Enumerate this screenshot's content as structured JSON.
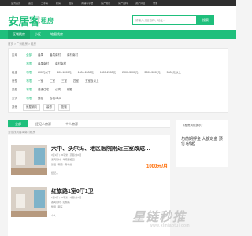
{
  "topbar": [
    "设为首页",
    "首页",
    "二手房",
    "新房",
    "租房",
    "商铺写字楼",
    "房产资讯",
    "房产百科",
    "资产评估",
    "登录"
  ],
  "header": {
    "logo": "安居客",
    "section": "租房",
    "search_placeholder": "请输入小区名称、地址…",
    "search_button": "搜索"
  },
  "nav": {
    "items": [
      "区域找房",
      "小区",
      "地图找房"
    ]
  },
  "breadcrumb": "首页 > 广州租房 > 租房",
  "filters": {
    "rows": [
      {
        "label": "区域",
        "options": [
          "全部",
          "番禺",
          "番禺南村",
          "南村南村"
        ]
      },
      {
        "label": "",
        "options": [
          "不限",
          "番禺南村",
          "南村南村"
        ]
      },
      {
        "label": "租金",
        "options": [
          "不限",
          "600元以下",
          "600-1000元",
          "1000-1500元",
          "1500-2000元",
          "2000-3000元",
          "3000-5000元",
          "5000元以上"
        ]
      },
      {
        "label": "房型",
        "options": [
          "不限",
          "一室",
          "二室",
          "三室",
          "四室",
          "五室及以上"
        ]
      },
      {
        "label": "类型",
        "options": [
          "不限",
          "普通住宅",
          "公寓",
          "别墅"
        ]
      },
      {
        "label": "方式",
        "options": [
          "不限",
          "整租",
          "合租/单间"
        ]
      },
      {
        "label": "其他",
        "options": [
          "房屋朝向",
          "装修",
          "配套"
        ]
      }
    ]
  },
  "tabs": [
    "全部",
    "经纪人房源",
    "个人房源"
  ],
  "result_count": "为您找到番禺南村租房",
  "listings": [
    {
      "title": "六中、沃尔玛、地区医院附近三室改成…",
      "line1": "3室1厅 | 85平米 | 高层/共6层",
      "line2": "番禺南村 · 华南碧桂园",
      "line3": "整租 · 朝南 · 有电梯",
      "line4": "经纪人",
      "price": "1000元/月"
    },
    {
      "title": "红旗路1室0厅1卫",
      "line1": "1室0厅 | 30平米 | 中层/共5层",
      "line2": "番禺南村 · 红旗路",
      "line3": "整租 · 朝东",
      "line4": "个人",
      "price": ""
    }
  ],
  "side": {
    "title": "《租房风险提示》",
    "body": "勿前期押金 大额定金 预付7折起"
  },
  "watermark": {
    "text": "星链秒推",
    "url": "www.xlmiaotui.com"
  }
}
